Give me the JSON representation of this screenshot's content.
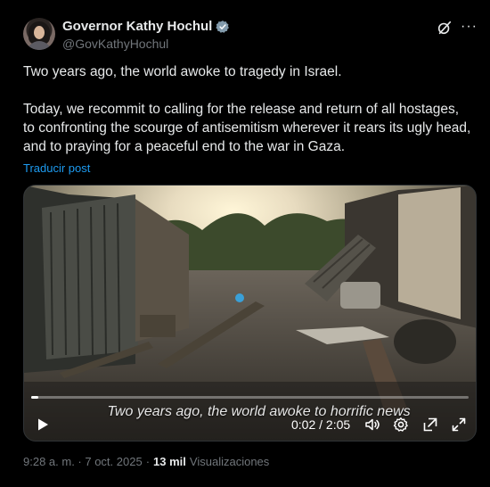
{
  "author": {
    "name": "Governor Kathy Hochul",
    "handle": "@GovKathyHochul"
  },
  "icons": {
    "verified": "verified-badge-icon",
    "grok": "grok-icon",
    "more": "more-icon",
    "play": "play-icon",
    "volume": "volume-icon",
    "settings": "settings-icon",
    "pip": "picture-in-picture-icon",
    "fullscreen": "fullscreen-icon"
  },
  "tweet": {
    "paragraph1": "Two years ago, the world awoke to tragedy in Israel.",
    "paragraph2": "Today, we recommit to calling for the release and return of all hostages, to confronting the scourge of antisemitism wherever it rears its ugly head, and to praying for a peaceful end to the war in Gaza.",
    "translate_label": "Traducir post"
  },
  "video": {
    "caption": "Two years ago, the world awoke to horrific news",
    "current_time": "0:02",
    "duration": "2:05",
    "time_display": "0:02 / 2:05",
    "progress_fraction": 0.016
  },
  "footer": {
    "timestamp": "9:28 a. m. · 7 oct. 2025",
    "separator": "·",
    "views_count": "13 mil",
    "views_label": "Visualizaciones"
  },
  "colors": {
    "background": "#000000",
    "text": "#e7e9ea",
    "secondary": "#71767b",
    "link": "#1d9bf0"
  }
}
